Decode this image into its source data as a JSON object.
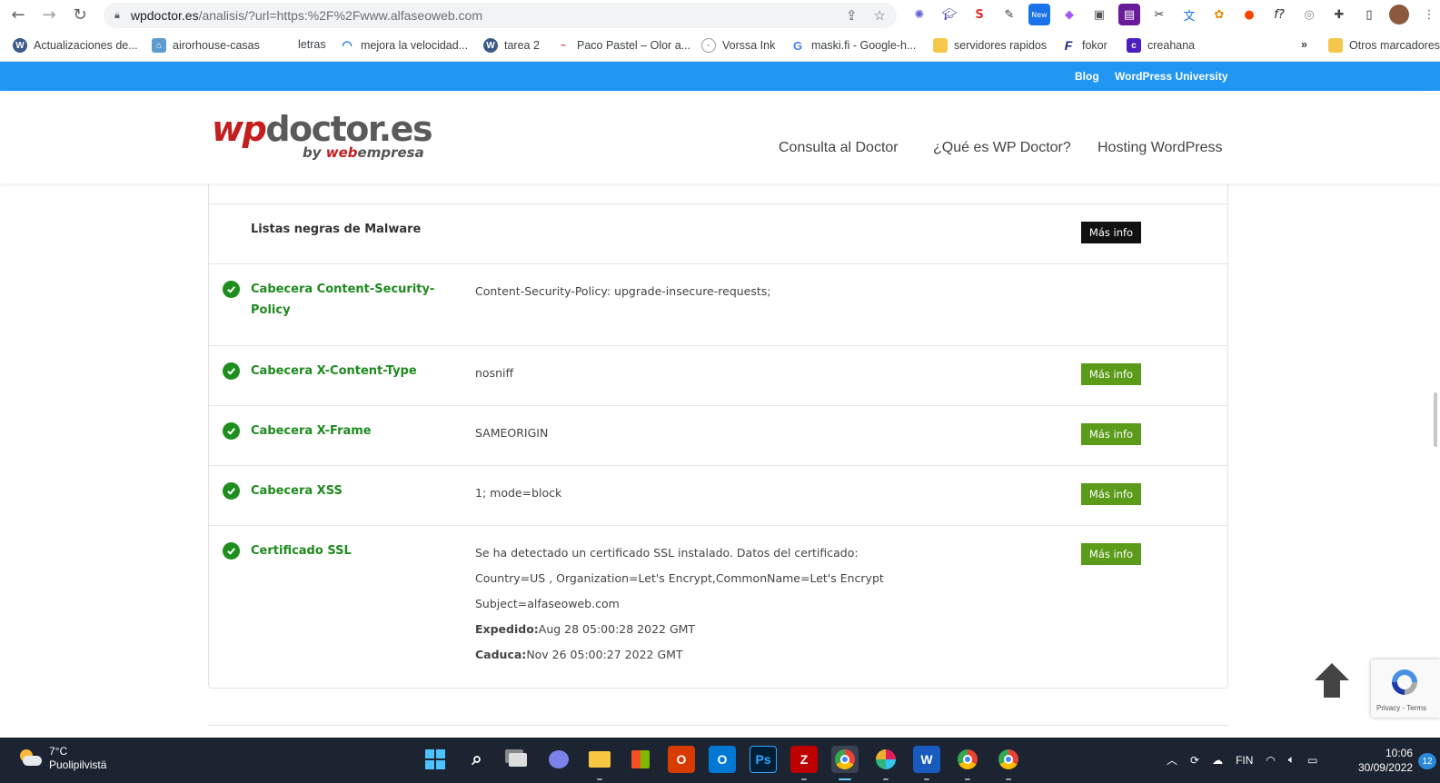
{
  "browser": {
    "url_host": "wpdoctor.es",
    "url_rest": "/analisis/?url=https:%2F%2Fwww.alfaseoweb.com",
    "bookmarks": [
      {
        "label": "Actualizaciones de...",
        "icon": "wordpress-icon"
      },
      {
        "label": "airorhouse-casas",
        "icon": "house-icon"
      },
      {
        "label": "letras",
        "icon": "blank-icon"
      },
      {
        "label": "mejora la velocidad...",
        "icon": "wifi-icon"
      },
      {
        "label": "tarea 2",
        "icon": "wordpress-icon"
      },
      {
        "label": "Paco Pastel – Olor a...",
        "icon": "line-icon"
      },
      {
        "label": "Vorssa Ink",
        "icon": "globe-icon"
      },
      {
        "label": "maski.fi - Google-h...",
        "icon": "google-icon"
      },
      {
        "label": "servidores rapidos",
        "icon": "folder-icon"
      },
      {
        "label": "fokor",
        "icon": "f-icon"
      },
      {
        "label": "creahana",
        "icon": "crehana-icon"
      }
    ],
    "more_bookmarks": "»",
    "other_bookmarks": "Otros marcadores"
  },
  "site": {
    "topbar_links": [
      "Blog",
      "WordPress University"
    ],
    "logo_prefix": "wp",
    "logo_main": "doctor.es",
    "logo_by": "by ",
    "logo_by_brand_red": "web",
    "logo_by_brand": "empresa",
    "nav": [
      "Consulta al Doctor",
      "¿Qué es WP Doctor?",
      "Hosting WordPress"
    ]
  },
  "results": [
    {
      "label": "Listas negras de Malware",
      "status": "none",
      "value": "",
      "button": "Más info",
      "button_style": "dark"
    },
    {
      "label": "Cabecera Content-Security-Policy",
      "status": "ok",
      "value": "Content-Security-Policy: upgrade-insecure-requests;",
      "button": "",
      "button_style": ""
    },
    {
      "label": "Cabecera X-Content-Type",
      "status": "ok",
      "value": "nosniff",
      "button": "Más info",
      "button_style": "green"
    },
    {
      "label": "Cabecera X-Frame",
      "status": "ok",
      "value": "SAMEORIGIN",
      "button": "Más info",
      "button_style": "green"
    },
    {
      "label": "Cabecera XSS",
      "status": "ok",
      "value": "1; mode=block",
      "button": "Más info",
      "button_style": "green"
    },
    {
      "label": "Certificado SSL",
      "status": "ok",
      "value": "",
      "button": "Más info",
      "button_style": "green"
    }
  ],
  "ssl": {
    "line1": "Se ha detectado un certificado SSL instalado. Datos del certificado:",
    "line2": "Country=US , Organization=Let's Encrypt,CommonName=Let's Encrypt",
    "line3": "Subject=alfaseoweb.com",
    "issued_label": "Expedido:",
    "issued_value": "Aug 28 05:00:28 2022 GMT",
    "expires_label": "Caduca:",
    "expires_value": "Nov 26 05:00:27 2022 GMT"
  },
  "recaptcha": {
    "text": "Privacy - Terms"
  },
  "taskbar": {
    "temperature": "7°C",
    "weather_desc": "Puolipilvistä",
    "language": "FIN",
    "time": "10:06",
    "date": "30/09/2022",
    "notifications": "12"
  },
  "colors": {
    "topbar": "#2196f3",
    "ok_green": "#1f8a1f",
    "button_green": "#5b9b19",
    "logo_red": "#c41e1e"
  }
}
